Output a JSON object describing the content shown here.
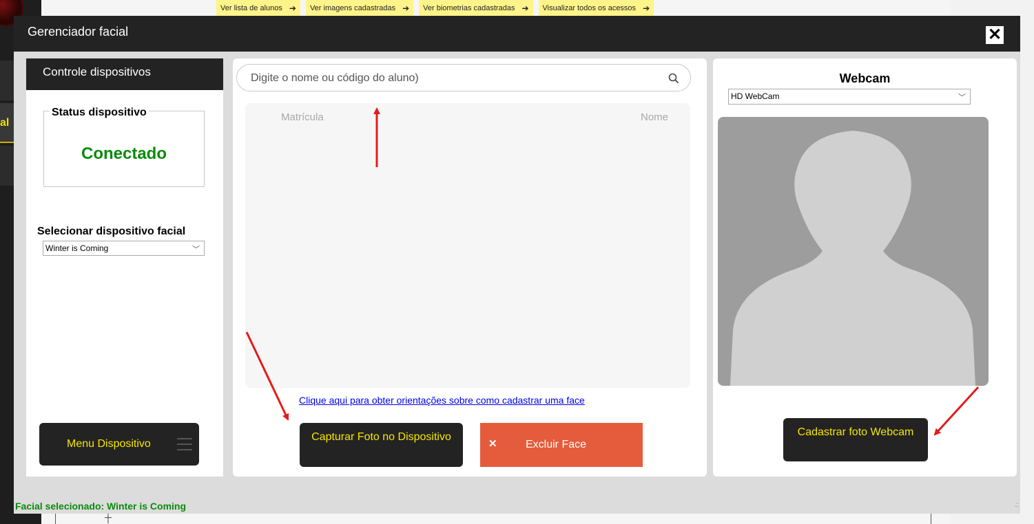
{
  "background": {
    "top_links": [
      {
        "label": "Ver lista de alunos",
        "icon": "circle-arrow-right-icon"
      },
      {
        "label": "Ver imagens cadastradas",
        "icon": "circle-arrow-right-icon"
      },
      {
        "label": "Ver biometrias cadastradas",
        "icon": "circle-arrow-right-icon"
      },
      {
        "label": "Visualizar todos os acessos",
        "icon": "circle-arrow-right-icon"
      }
    ],
    "sidebar_partial_text": "al"
  },
  "dialog": {
    "title": "Gerenciador facial",
    "close_icon": "close-icon"
  },
  "left_panel": {
    "header": "Controle dispositivos",
    "status_label": "Status dispositivo",
    "status_value": "Conectado",
    "select_label": "Selecionar dispositivo facial",
    "selected_device": "Winter is Coming",
    "menu_button": "Menu Dispositivo"
  },
  "middle_panel": {
    "search_placeholder": "Digite o nome ou código do aluno)",
    "columns": [
      "Matrícula",
      "Nome"
    ],
    "rows": [],
    "help_link": "Clique aqui para obter orientações sobre como cadastrar uma face",
    "capture_button": "Capturar Foto no Dispositivo",
    "delete_button": "Excluir Face"
  },
  "right_panel": {
    "title": "Webcam",
    "selected_camera": "HD WebCam",
    "register_button": "Cadastrar foto Webcam"
  },
  "statusbar": {
    "text": "Facial selecionado: Winter is Coming"
  },
  "colors": {
    "accent_yellow": "#f7e600",
    "dark": "#232323",
    "danger": "#e55c3c",
    "success": "#0a8a0a",
    "annotation_red": "#e41b1b"
  }
}
